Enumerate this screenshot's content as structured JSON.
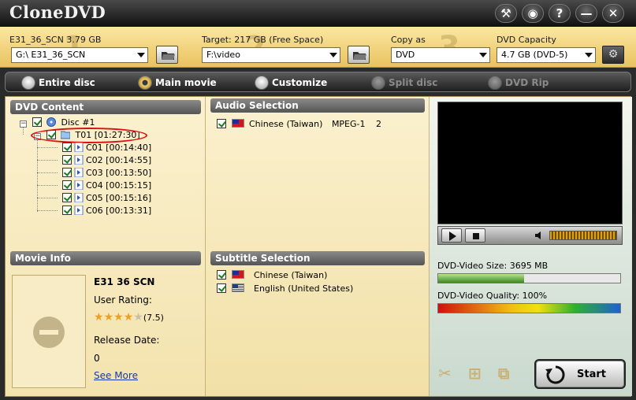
{
  "app": {
    "title": "CloneDVD"
  },
  "window_buttons": [
    {
      "name": "tools",
      "glyph": "⚒"
    },
    {
      "name": "web",
      "glyph": "◉"
    },
    {
      "name": "help",
      "glyph": "?"
    },
    {
      "name": "minimize",
      "glyph": "—"
    },
    {
      "name": "close",
      "glyph": "✕"
    }
  ],
  "source": {
    "label": "E31_36_SCN 3.79 GB",
    "value": "G:\\ E31_36_SCN",
    "step": "1"
  },
  "target": {
    "label": "Target: 217 GB (Free Space)",
    "value": "F:\\video",
    "step": "2"
  },
  "copy_as": {
    "label": "Copy as",
    "value": "DVD",
    "step": "3"
  },
  "capacity": {
    "label": "DVD Capacity",
    "value": "4.7 GB (DVD-5)"
  },
  "modes": [
    {
      "label": "Entire disc",
      "selected": false,
      "enabled": true
    },
    {
      "label": "Main movie",
      "selected": true,
      "enabled": true
    },
    {
      "label": "Customize",
      "selected": false,
      "enabled": true
    },
    {
      "label": "Split disc",
      "selected": false,
      "enabled": false
    },
    {
      "label": "DVD Rip",
      "selected": false,
      "enabled": false
    }
  ],
  "dvd_content": {
    "title": "DVD Content",
    "disc": "Disc #1",
    "title_item": "T01 [01:27:30]",
    "chapters": [
      "C01 [00:14:40]",
      "C02 [00:14:55]",
      "C03 [00:13:50]",
      "C04 [00:15:15]",
      "C05 [00:15:16]",
      "C06 [00:13:31]"
    ]
  },
  "audio": {
    "title": "Audio Selection",
    "language": "Chinese (Taiwan)",
    "codec": "MPEG-1",
    "channels": "2"
  },
  "subtitle": {
    "title": "Subtitle Selection",
    "items": [
      "Chinese (Taiwan)",
      "English (United States)"
    ]
  },
  "movie_info": {
    "title": "Movie Info",
    "name": "E31 36 SCN",
    "rating_label": "User Rating:",
    "rating_value": "(7.5)",
    "release_label": "Release Date:",
    "release_value": "0",
    "see_more": "See More"
  },
  "meters": {
    "size_label": "DVD-Video Size: 3695 MB",
    "size_fraction": 0.47,
    "quality_label": "DVD-Video Quality: 100%",
    "quality_fraction": 1.0
  },
  "start_label": "Start"
}
